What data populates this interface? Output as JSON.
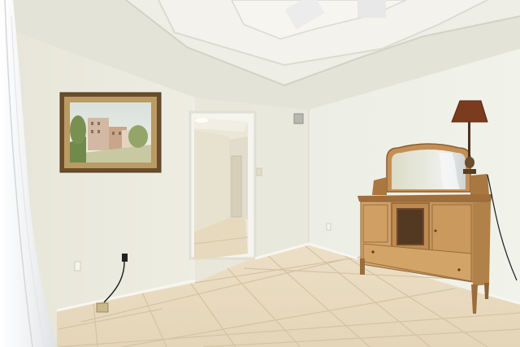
{
  "scene": {
    "description_free": true,
    "colors": {
      "wall_left": "#ecebdf",
      "wall_right": "#eeeee4",
      "wall_back": "#e6e5d8",
      "ceiling": "#e8e7de",
      "tray_ceiling": "#f2f1ea",
      "floor_tile": "#e6d8bd",
      "grout": "#cdbf9e",
      "wood": "#c79a62",
      "wood_dark": "#8d6437",
      "frame_gold": "#8a6a3c",
      "curtain": "#f7f7f8"
    }
  }
}
